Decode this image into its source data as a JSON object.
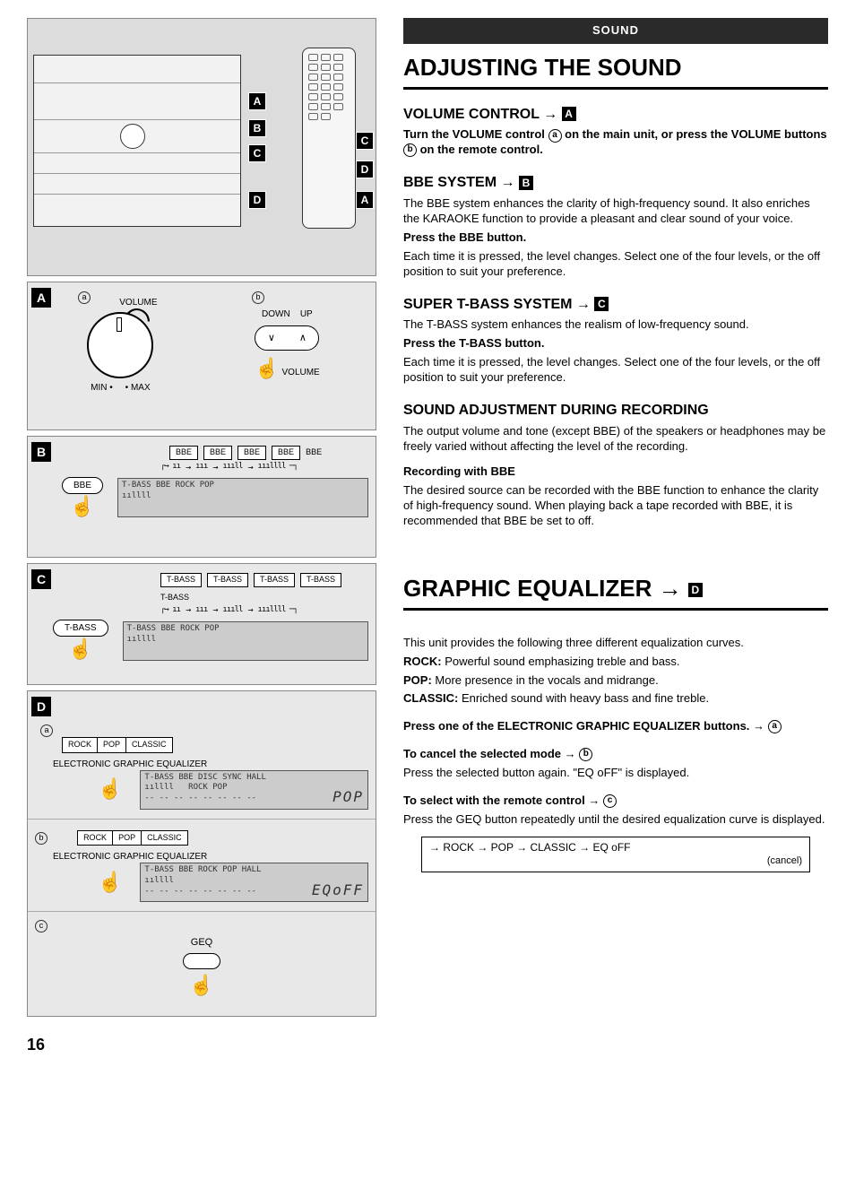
{
  "page_number": "16",
  "banner": "SOUND",
  "title1": "ADJUSTING THE SOUND",
  "section_volume": {
    "heading": "VOLUME CONTROL →",
    "ref": "A",
    "body1_a": "Turn the VOLUME control ",
    "body1_b": " on the main unit, or press the VOLUME buttons ",
    "body1_c": " on the remote control.",
    "circ_a": "a",
    "circ_b": "b"
  },
  "section_bbe": {
    "heading": "BBE SYSTEM →",
    "ref": "B",
    "p1": "The BBE system enhances the clarity of high-frequency sound. It also enriches the KARAOKE function to provide a pleasant and clear sound of your voice.",
    "p2_bold": "Press the BBE button.",
    "p3": "Each time it is pressed, the level changes. Select one of the four levels, or the off position to suit your preference."
  },
  "section_tbass": {
    "heading": "SUPER T-BASS SYSTEM →",
    "ref": "C",
    "p1": "The T-BASS system enhances the realism of low-frequency sound.",
    "p2_bold": "Press the T-BASS button.",
    "p3": "Each time it is pressed, the level changes. Select one of the four levels, or the off position to suit your preference."
  },
  "section_record": {
    "heading": "SOUND ADJUSTMENT DURING RECORDING",
    "p1": "The output volume and tone (except BBE) of the speakers or headphones may be freely varied without affecting the level of the recording.",
    "p2_bold": "Recording with BBE",
    "p3": "The desired source can be recorded with the BBE function to enhance the clarity of high-frequency sound. When playing back a tape recorded with BBE, it is recommended that BBE be set to off."
  },
  "title2": "GRAPHIC EQUALIZER →",
  "title2_ref": "D",
  "section_geq": {
    "p1": "This unit provides the following three different equalization curves.",
    "rock_lbl": "ROCK:",
    "rock_txt": " Powerful sound emphasizing treble and bass.",
    "pop_lbl": "POP:",
    "pop_txt": " More presence in the vocals and midrange.",
    "classic_lbl": "CLASSIC:",
    "classic_txt": " Enriched sound with heavy bass and fine treble.",
    "press_a": "Press one of the ELECTRONIC GRAPHIC EQUALIZER buttons. → ",
    "press_circ": "a",
    "cancel_lbl": "To cancel the selected mode → ",
    "cancel_circ": "b",
    "cancel_txt": "Press the selected button again. \"EQ oFF\" is displayed.",
    "remote_lbl": "To select with the remote control → ",
    "remote_circ": "c",
    "remote_txt": "Press the GEQ button repeatedly until the desired equalization curve is displayed.",
    "cycle": "→ ROCK → POP → CLASSIC → EQ oFF",
    "cycle_sub": "(cancel)"
  },
  "diagram": {
    "callouts_main": [
      "A",
      "B",
      "C",
      "D"
    ],
    "callouts_remote": [
      "C",
      "D",
      "A"
    ],
    "panelA": {
      "label": "A",
      "circ_a": "a",
      "circ_b": "b",
      "volume_lbl": "VOLUME",
      "down": "DOWN",
      "up": "UP",
      "min": "MIN",
      "max": "MAX",
      "volume_lbl2": "VOLUME"
    },
    "panelB": {
      "label": "B",
      "btn": "BBE",
      "seq": [
        "BBE",
        "BBE",
        "BBE",
        "BBE",
        "BBE"
      ]
    },
    "panelC": {
      "label": "C",
      "btn": "T-BASS",
      "seq": [
        "T-BASS",
        "T-BASS",
        "T-BASS",
        "T-BASS",
        "T-BASS"
      ]
    },
    "panelD": {
      "label": "D",
      "circ_a": "a",
      "circ_b": "b",
      "circ_c": "c",
      "btns": [
        "ROCK",
        "POP",
        "CLASSIC"
      ],
      "eq_label": "ELECTRONIC GRAPHIC EQUALIZER",
      "disp1": "POP",
      "disp2": "EQoFF",
      "geq": "GEQ"
    }
  }
}
